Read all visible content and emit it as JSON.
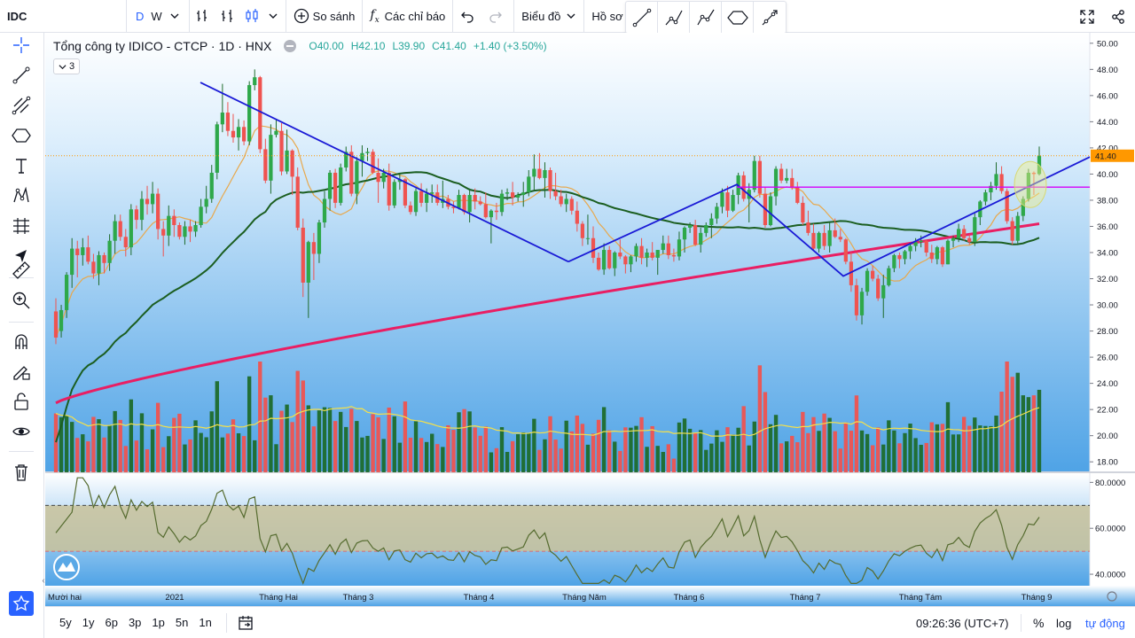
{
  "toolbar": {
    "symbol": "IDC",
    "interval_d": "D",
    "interval_w": "W",
    "compare_label": "So sánh",
    "indicators_label": "Các chỉ báo",
    "chart_label": "Biểu đồ",
    "profile_label": "Hồ sơ"
  },
  "legend": {
    "title": "Tổng công ty IDICO - CTCP · 1D · HNX",
    "open": "O40.00",
    "high": "H42.10",
    "low": "L39.90",
    "close": "C41.40",
    "change": "+1.40 (+3.50%)",
    "indicator_count": "3"
  },
  "bottom": {
    "ranges": [
      "5y",
      "1y",
      "6p",
      "3p",
      "1p",
      "5n",
      "1n"
    ],
    "clock": "09:26:36 (UTC+7)",
    "percent": "%",
    "log": "log",
    "auto": "tự động"
  },
  "colors": {
    "up": "#1e6b2c",
    "down": "#ef5350",
    "ma_short": "#e8a84c",
    "ma_mid": "#1b5e20",
    "ma_long": "#e91e63",
    "trendline": "#1a1ad6",
    "resistance": "#d500f9",
    "rsi_line": "#556b2f",
    "bg_top": "#ffffff",
    "bg_bottom": "#4fa3e6",
    "last_price_bg": "#ff9800"
  },
  "chart_data": {
    "type": "candlestick",
    "y_axis_ticks": [
      "50.00",
      "48.00",
      "46.00",
      "44.00",
      "42.00",
      "40.00",
      "38.00",
      "36.00",
      "34.00",
      "32.00",
      "30.00",
      "28.00",
      "26.00",
      "24.00",
      "22.00",
      "20.00",
      "18.00"
    ],
    "ylim": [
      17.2,
      50.8
    ],
    "rsi_ticks": [
      "80.0000",
      "60.0000",
      "40.0000"
    ],
    "rsi_ylim": [
      35,
      84
    ],
    "rsi_levels": [
      70,
      50
    ],
    "x_labels": [
      "Mười hai",
      "2021",
      "Tháng Hai",
      "Tháng 3",
      "Tháng 4",
      "Tháng Năm",
      "Tháng 6",
      "Tháng 7",
      "Tháng Tám",
      "Tháng 9"
    ],
    "last_price": "41.40",
    "last_price_value": 41.4,
    "resistance_level": 39.0,
    "candles": [
      [
        29.5,
        30.5,
        27.0,
        27.5
      ],
      [
        28.0,
        30.0,
        27.5,
        29.6
      ],
      [
        29.6,
        32.5,
        29.0,
        32.3
      ],
      [
        32.3,
        35.1,
        31.3,
        34.3
      ],
      [
        34.3,
        34.9,
        32.1,
        33.8
      ],
      [
        33.8,
        35.1,
        33.0,
        34.4
      ],
      [
        34.4,
        35.3,
        33.1,
        33.3
      ],
      [
        33.3,
        33.9,
        32.0,
        32.4
      ],
      [
        32.4,
        34.1,
        31.5,
        33.8
      ],
      [
        33.8,
        34.0,
        32.4,
        33.2
      ],
      [
        33.2,
        35.4,
        32.6,
        34.9
      ],
      [
        34.9,
        36.9,
        33.9,
        36.4
      ],
      [
        36.4,
        36.9,
        34.9,
        35.2
      ],
      [
        35.2,
        35.8,
        33.7,
        34.4
      ],
      [
        34.4,
        37.7,
        33.8,
        37.3
      ],
      [
        37.3,
        37.6,
        35.8,
        36.5
      ],
      [
        36.5,
        38.7,
        35.7,
        38.1
      ],
      [
        38.1,
        39.1,
        36.9,
        37.7
      ],
      [
        37.7,
        39.4,
        37.0,
        38.5
      ],
      [
        38.5,
        38.9,
        35.0,
        35.8
      ],
      [
        35.8,
        36.4,
        33.7,
        35.3
      ],
      [
        35.3,
        37.6,
        34.5,
        36.8
      ],
      [
        36.8,
        37.3,
        35.2,
        36.1
      ],
      [
        36.1,
        36.3,
        35.0,
        35.2
      ],
      [
        35.2,
        36.4,
        34.6,
        36.0
      ],
      [
        36.0,
        36.5,
        34.8,
        35.6
      ],
      [
        35.6,
        36.4,
        35.2,
        36.1
      ],
      [
        36.1,
        38.1,
        35.9,
        37.5
      ],
      [
        37.5,
        39.1,
        37.0,
        38.1
      ],
      [
        38.1,
        40.7,
        37.8,
        40.1
      ],
      [
        40.1,
        44.0,
        39.6,
        43.8
      ],
      [
        43.8,
        46.9,
        43.2,
        44.7
      ],
      [
        44.7,
        45.5,
        42.9,
        43.3
      ],
      [
        43.3,
        44.6,
        42.4,
        42.8
      ],
      [
        42.8,
        44.2,
        41.8,
        43.6
      ],
      [
        43.6,
        44.1,
        42.2,
        42.5
      ],
      [
        42.5,
        47.1,
        42.2,
        46.8
      ],
      [
        46.8,
        48.0,
        46.4,
        47.4
      ],
      [
        47.4,
        47.5,
        41.6,
        41.9
      ],
      [
        41.9,
        42.7,
        39.3,
        39.5
      ],
      [
        39.5,
        43.8,
        38.5,
        43.0
      ],
      [
        43.0,
        44.2,
        42.8,
        43.3
      ],
      [
        43.3,
        43.9,
        39.9,
        40.2
      ],
      [
        40.2,
        43.4,
        40.0,
        41.8
      ],
      [
        41.8,
        41.9,
        38.4,
        39.8
      ],
      [
        39.8,
        40.5,
        35.7,
        35.9
      ],
      [
        35.9,
        36.6,
        30.6,
        31.7
      ],
      [
        31.7,
        34.9,
        29.0,
        34.8
      ],
      [
        34.8,
        35.5,
        31.9,
        33.9
      ],
      [
        33.9,
        36.5,
        33.2,
        36.3
      ],
      [
        36.3,
        38.7,
        35.9,
        38.1
      ],
      [
        38.1,
        40.3,
        37.2,
        40.1
      ],
      [
        40.1,
        40.4,
        37.4,
        37.8
      ],
      [
        37.8,
        40.8,
        37.6,
        40.5
      ],
      [
        40.5,
        42.1,
        40.2,
        41.7
      ],
      [
        41.7,
        42.2,
        38.3,
        38.5
      ],
      [
        38.5,
        41.3,
        37.7,
        41.0
      ],
      [
        41.0,
        42.2,
        39.8,
        41.6
      ],
      [
        41.6,
        42.0,
        41.0,
        41.7
      ],
      [
        41.7,
        41.9,
        40.0,
        40.1
      ],
      [
        40.1,
        41.2,
        37.8,
        39.4
      ],
      [
        39.4,
        40.4,
        38.9,
        40.1
      ],
      [
        40.1,
        40.8,
        37.2,
        37.6
      ],
      [
        37.6,
        39.6,
        37.4,
        39.4
      ],
      [
        39.4,
        40.1,
        38.8,
        39.6
      ],
      [
        39.6,
        39.7,
        37.4,
        37.6
      ],
      [
        37.6,
        37.9,
        36.9,
        37.1
      ],
      [
        37.1,
        38.9,
        36.8,
        38.7
      ],
      [
        38.7,
        39.3,
        37.5,
        37.8
      ],
      [
        37.8,
        38.9,
        37.1,
        38.5
      ],
      [
        38.5,
        39.2,
        37.8,
        38.6
      ],
      [
        38.6,
        39.2,
        37.6,
        37.8
      ],
      [
        37.8,
        39.5,
        37.4,
        38.1
      ],
      [
        38.1,
        38.4,
        37.3,
        37.5
      ],
      [
        37.5,
        37.9,
        37.0,
        37.4
      ],
      [
        37.4,
        38.8,
        37.3,
        38.4
      ],
      [
        38.4,
        38.5,
        36.9,
        37.1
      ],
      [
        37.1,
        38.9,
        36.3,
        38.4
      ],
      [
        38.4,
        38.9,
        37.3,
        37.9
      ],
      [
        37.9,
        38.3,
        37.6,
        37.7
      ],
      [
        37.7,
        38.6,
        36.6,
        36.7
      ],
      [
        36.7,
        37.3,
        34.7,
        37.2
      ],
      [
        37.2,
        37.8,
        36.5,
        37.1
      ],
      [
        37.1,
        38.8,
        36.8,
        38.5
      ],
      [
        38.5,
        38.9,
        38.0,
        38.6
      ],
      [
        38.6,
        39.4,
        37.6,
        38.2
      ],
      [
        38.2,
        38.6,
        37.9,
        38.4
      ],
      [
        38.4,
        39.4,
        37.5,
        38.6
      ],
      [
        38.6,
        40.3,
        38.3,
        39.8
      ],
      [
        39.8,
        41.5,
        38.8,
        40.4
      ],
      [
        40.4,
        41.6,
        39.6,
        39.7
      ],
      [
        39.7,
        40.9,
        38.2,
        40.3
      ],
      [
        40.3,
        40.5,
        38.1,
        38.7
      ],
      [
        38.7,
        40.1,
        38.0,
        38.3
      ],
      [
        38.3,
        38.8,
        37.5,
        37.7
      ],
      [
        37.7,
        38.5,
        37.1,
        38.1
      ],
      [
        38.1,
        38.3,
        36.9,
        37.2
      ],
      [
        37.2,
        37.9,
        35.6,
        36.2
      ],
      [
        36.2,
        36.4,
        34.5,
        35.1
      ],
      [
        35.1,
        36.9,
        34.6,
        35.1
      ],
      [
        35.1,
        36.0,
        33.2,
        33.6
      ],
      [
        33.6,
        34.0,
        32.6,
        32.7
      ],
      [
        32.7,
        34.7,
        32.3,
        34.2
      ],
      [
        34.2,
        34.5,
        32.7,
        32.8
      ],
      [
        32.8,
        34.1,
        32.2,
        34.0
      ],
      [
        34.0,
        35.0,
        33.5,
        33.7
      ],
      [
        33.7,
        33.8,
        32.4,
        33.1
      ],
      [
        33.1,
        33.8,
        32.5,
        33.7
      ],
      [
        33.7,
        34.7,
        33.3,
        34.5
      ],
      [
        34.5,
        35.1,
        33.1,
        33.6
      ],
      [
        33.6,
        34.3,
        32.9,
        34.0
      ],
      [
        34.0,
        34.8,
        33.4,
        33.6
      ],
      [
        33.6,
        34.2,
        32.3,
        34.2
      ],
      [
        34.2,
        35.3,
        33.9,
        34.7
      ],
      [
        34.7,
        35.3,
        33.5,
        33.8
      ],
      [
        33.8,
        34.3,
        33.3,
        33.7
      ],
      [
        33.7,
        35.6,
        33.4,
        35.0
      ],
      [
        35.0,
        36.0,
        34.0,
        35.9
      ],
      [
        35.9,
        36.3,
        35.5,
        36.1
      ],
      [
        36.1,
        36.5,
        34.5,
        34.6
      ],
      [
        34.6,
        35.9,
        34.0,
        35.5
      ],
      [
        35.5,
        36.3,
        35.2,
        36.1
      ],
      [
        36.1,
        37.0,
        35.1,
        36.6
      ],
      [
        36.6,
        37.8,
        36.2,
        37.5
      ],
      [
        37.5,
        38.9,
        37.0,
        38.6
      ],
      [
        38.6,
        39.1,
        36.7,
        37.2
      ],
      [
        37.2,
        38.8,
        37.1,
        38.4
      ],
      [
        38.4,
        40.1,
        37.7,
        39.9
      ],
      [
        39.9,
        40.2,
        37.9,
        38.1
      ],
      [
        38.1,
        39.3,
        36.3,
        38.8
      ],
      [
        38.8,
        41.4,
        38.6,
        41.0
      ],
      [
        41.0,
        41.4,
        38.2,
        38.5
      ],
      [
        38.5,
        39.0,
        35.9,
        36.1
      ],
      [
        36.1,
        38.6,
        36.0,
        38.3
      ],
      [
        38.3,
        40.6,
        37.6,
        40.4
      ],
      [
        40.4,
        40.8,
        39.3,
        39.5
      ],
      [
        39.5,
        40.4,
        39.3,
        39.7
      ],
      [
        39.7,
        40.4,
        38.8,
        39.0
      ],
      [
        39.0,
        39.4,
        37.7,
        37.8
      ],
      [
        37.8,
        38.3,
        36.1,
        36.3
      ],
      [
        36.3,
        37.2,
        35.3,
        35.5
      ],
      [
        35.5,
        36.2,
        34.1,
        34.3
      ],
      [
        34.3,
        35.6,
        34.0,
        35.5
      ],
      [
        35.5,
        36.1,
        34.2,
        34.5
      ],
      [
        34.5,
        36.3,
        34.0,
        35.7
      ],
      [
        35.7,
        36.6,
        35.1,
        35.2
      ],
      [
        35.2,
        35.8,
        34.8,
        35.0
      ],
      [
        35.0,
        35.1,
        33.1,
        33.3
      ],
      [
        33.3,
        34.0,
        31.0,
        31.5
      ],
      [
        31.5,
        32.0,
        28.8,
        29.2
      ],
      [
        29.2,
        31.3,
        28.5,
        31.0
      ],
      [
        31.0,
        32.8,
        30.7,
        32.6
      ],
      [
        32.6,
        33.0,
        31.8,
        32.0
      ],
      [
        32.0,
        32.3,
        30.3,
        30.5
      ],
      [
        30.5,
        32.3,
        29.0,
        31.5
      ],
      [
        31.5,
        33.0,
        31.4,
        32.8
      ],
      [
        32.8,
        33.9,
        32.5,
        33.8
      ],
      [
        33.8,
        34.0,
        32.8,
        33.5
      ],
      [
        33.5,
        34.2,
        33.1,
        34.1
      ],
      [
        34.1,
        34.7,
        33.5,
        34.5
      ],
      [
        34.5,
        35.1,
        34.1,
        34.8
      ],
      [
        34.8,
        35.3,
        34.4,
        34.9
      ],
      [
        34.9,
        35.0,
        33.7,
        34.0
      ],
      [
        34.0,
        34.6,
        33.2,
        33.5
      ],
      [
        33.5,
        34.5,
        33.1,
        34.4
      ],
      [
        34.4,
        34.5,
        32.9,
        33.1
      ],
      [
        33.1,
        35.0,
        33.1,
        34.9
      ],
      [
        34.9,
        35.3,
        34.4,
        35.1
      ],
      [
        35.1,
        36.2,
        34.8,
        35.8
      ],
      [
        35.8,
        36.1,
        34.9,
        35.1
      ],
      [
        35.1,
        35.4,
        34.6,
        34.8
      ],
      [
        34.8,
        37.0,
        34.5,
        36.7
      ],
      [
        36.7,
        38.0,
        36.1,
        37.9
      ],
      [
        37.9,
        38.8,
        37.6,
        38.6
      ],
      [
        38.6,
        39.4,
        38.0,
        39.1
      ],
      [
        39.1,
        40.9,
        38.8,
        40.0
      ],
      [
        40.0,
        40.6,
        38.5,
        38.7
      ],
      [
        38.7,
        38.9,
        36.2,
        36.4
      ],
      [
        36.4,
        36.7,
        34.6,
        34.9
      ],
      [
        34.9,
        37.1,
        34.7,
        36.8
      ],
      [
        36.8,
        38.3,
        36.4,
        38.1
      ],
      [
        38.1,
        40.4,
        37.9,
        40.1
      ],
      [
        40.1,
        40.2,
        38.4,
        40.0
      ],
      [
        40.0,
        42.1,
        39.9,
        41.4
      ]
    ],
    "ma_short": [],
    "ma_mid": [],
    "ma_long": [],
    "volume": []
  }
}
